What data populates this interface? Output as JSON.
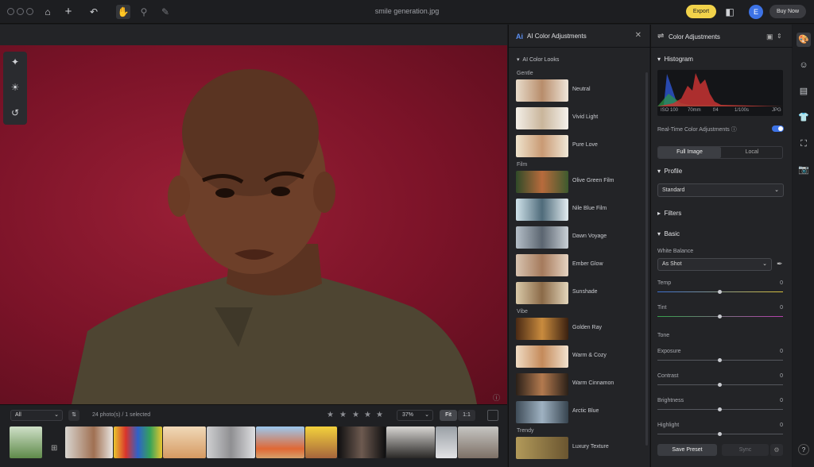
{
  "window": {
    "title": "smile generation.jpg",
    "export": "Export",
    "buy": "Buy Now",
    "avatar": "E"
  },
  "filmstrip": {
    "filter": "All",
    "count": "24 photo(s) / 1 selected",
    "zoom": "37%",
    "fit": "Fit",
    "one": "1:1"
  },
  "looks": {
    "title": "AI Color Adjustments",
    "section": "AI Color Looks",
    "groups": [
      {
        "name": "Gentle",
        "items": [
          "Neutral",
          "Vivid Light",
          "Pure Love"
        ]
      },
      {
        "name": "Film",
        "items": [
          "Olive Green Film",
          "Nile Blue Film",
          "Dawn Voyage",
          "Ember Glow",
          "Sunshade"
        ]
      },
      {
        "name": "Vibe",
        "items": [
          "Golden Ray",
          "Warm & Cozy",
          "Warm Cinnamon",
          "Arctic Blue"
        ]
      },
      {
        "name": "Trendy",
        "items": [
          "Luxury Texture"
        ]
      }
    ]
  },
  "adjust": {
    "title": "Color Adjustments",
    "histogram": "Histogram",
    "exif": [
      "ISO 100",
      "70mm",
      "f/4",
      "1/100s",
      "JPG"
    ],
    "realtime": "Real-Time Color Adjustments",
    "tabs": [
      "Full Image",
      "Local"
    ],
    "profile": "Profile",
    "profileValue": "Standard",
    "filters": "Filters",
    "basic": "Basic",
    "wb": "White Balance",
    "wbValue": "As Shot",
    "temp": {
      "label": "Temp",
      "value": "0"
    },
    "tint": {
      "label": "Tint",
      "value": "0"
    },
    "tone": "Tone",
    "exposure": {
      "label": "Exposure",
      "value": "0"
    },
    "contrast": {
      "label": "Contrast",
      "value": "0"
    },
    "brightness": {
      "label": "Brightness",
      "value": "0"
    },
    "highlight": {
      "label": "Highlight",
      "value": "0"
    },
    "savePreset": "Save Preset",
    "sync": "Sync"
  },
  "help": "?",
  "colors": {
    "accent": "#3d73e6",
    "export": "#f1d24a",
    "backdrop": "#7b1328"
  }
}
